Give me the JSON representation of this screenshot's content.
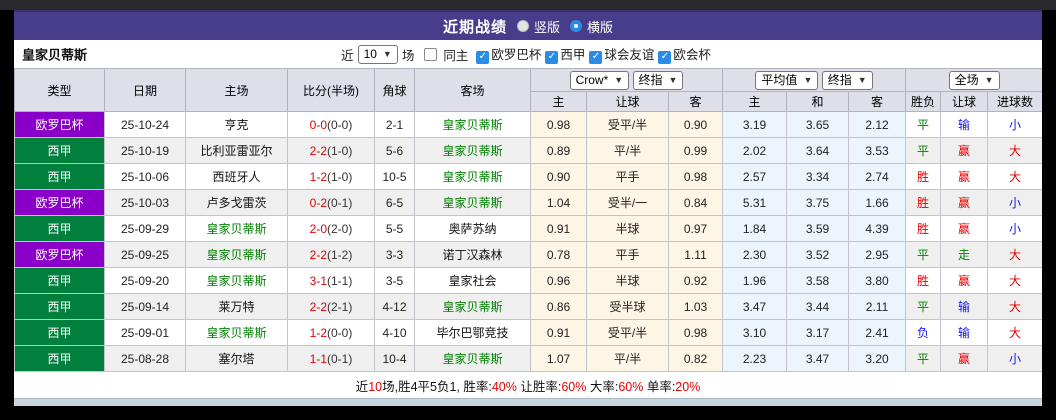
{
  "title_bar": {
    "title": "近期战绩",
    "radio_vertical": "竖版",
    "radio_horizontal": "横版",
    "selected": "横版"
  },
  "filter": {
    "team": "皇家贝蒂斯",
    "prefix": "近",
    "count_value": "10",
    "suffix": "场",
    "same_home": {
      "label": "同主",
      "checked": false
    },
    "leagues": [
      {
        "label": "欧罗巴杯",
        "checked": true
      },
      {
        "label": "西甲",
        "checked": true
      },
      {
        "label": "球会友谊",
        "checked": true
      },
      {
        "label": "欧会杯",
        "checked": true
      }
    ]
  },
  "table": {
    "selects": {
      "company": "Crow*",
      "company_final": "终指",
      "average": "平均值",
      "average_final": "终指",
      "fulltime": "全场"
    },
    "columns": [
      "类型",
      "日期",
      "主场",
      "比分(半场)",
      "角球",
      "客场",
      "主",
      "让球",
      "客",
      "主",
      "和",
      "客",
      "胜负",
      "让球",
      "进球数"
    ],
    "rows": [
      {
        "league": "欧罗巴杯",
        "date": "25-10-24",
        "home": "亨克",
        "score": "0-0",
        "half": "(0-0)",
        "corner": "2-1",
        "away": "皇家贝蒂斯",
        "focus": "away",
        "crown_home": "0.98",
        "handicap": "受平/半",
        "crown_away": "0.90",
        "avg_home": "3.19",
        "avg_draw": "3.65",
        "avg_away": "2.12",
        "result_wdl": "平",
        "result_handicap": "输",
        "result_goals": "小"
      },
      {
        "league": "西甲",
        "date": "25-10-19",
        "home": "比利亚雷亚尔",
        "score": "2-2",
        "half": "(1-0)",
        "corner": "5-6",
        "away": "皇家贝蒂斯",
        "focus": "away",
        "crown_home": "0.89",
        "handicap": "平/半",
        "crown_away": "0.99",
        "avg_home": "2.02",
        "avg_draw": "3.64",
        "avg_away": "3.53",
        "result_wdl": "平",
        "result_handicap": "赢",
        "result_goals": "大"
      },
      {
        "league": "西甲",
        "date": "25-10-06",
        "home": "西班牙人",
        "score": "1-2",
        "half": "(1-0)",
        "corner": "10-5",
        "away": "皇家贝蒂斯",
        "focus": "away",
        "crown_home": "0.90",
        "handicap": "平手",
        "crown_away": "0.98",
        "avg_home": "2.57",
        "avg_draw": "3.34",
        "avg_away": "2.74",
        "result_wdl": "胜",
        "result_handicap": "赢",
        "result_goals": "大"
      },
      {
        "league": "欧罗巴杯",
        "date": "25-10-03",
        "home": "卢多戈雷茨",
        "score": "0-2",
        "half": "(0-1)",
        "corner": "6-5",
        "away": "皇家贝蒂斯",
        "focus": "away",
        "crown_home": "1.04",
        "handicap": "受半/一",
        "crown_away": "0.84",
        "avg_home": "5.31",
        "avg_draw": "3.75",
        "avg_away": "1.66",
        "result_wdl": "胜",
        "result_handicap": "赢",
        "result_goals": "小"
      },
      {
        "league": "西甲",
        "date": "25-09-29",
        "home": "皇家贝蒂斯",
        "score": "2-0",
        "half": "(2-0)",
        "corner": "5-5",
        "away": "奥萨苏纳",
        "focus": "home",
        "crown_home": "0.91",
        "handicap": "半球",
        "crown_away": "0.97",
        "avg_home": "1.84",
        "avg_draw": "3.59",
        "avg_away": "4.39",
        "result_wdl": "胜",
        "result_handicap": "赢",
        "result_goals": "小"
      },
      {
        "league": "欧罗巴杯",
        "date": "25-09-25",
        "home": "皇家贝蒂斯",
        "score": "2-2",
        "half": "(1-2)",
        "corner": "3-3",
        "away": "诺丁汉森林",
        "focus": "home",
        "crown_home": "0.78",
        "handicap": "平手",
        "crown_away": "1.11",
        "avg_home": "2.30",
        "avg_draw": "3.52",
        "avg_away": "2.95",
        "result_wdl": "平",
        "result_handicap": "走",
        "result_goals": "大"
      },
      {
        "league": "西甲",
        "date": "25-09-20",
        "home": "皇家贝蒂斯",
        "score": "3-1",
        "half": "(1-1)",
        "corner": "3-5",
        "away": "皇家社会",
        "focus": "home",
        "crown_home": "0.96",
        "handicap": "半球",
        "crown_away": "0.92",
        "avg_home": "1.96",
        "avg_draw": "3.58",
        "avg_away": "3.80",
        "result_wdl": "胜",
        "result_handicap": "赢",
        "result_goals": "大"
      },
      {
        "league": "西甲",
        "date": "25-09-14",
        "home": "莱万特",
        "score": "2-2",
        "half": "(2-1)",
        "corner": "4-12",
        "away": "皇家贝蒂斯",
        "focus": "away",
        "crown_home": "0.86",
        "handicap": "受半球",
        "crown_away": "1.03",
        "avg_home": "3.47",
        "avg_draw": "3.44",
        "avg_away": "2.11",
        "result_wdl": "平",
        "result_handicap": "输",
        "result_goals": "大"
      },
      {
        "league": "西甲",
        "date": "25-09-01",
        "home": "皇家贝蒂斯",
        "score": "1-2",
        "half": "(0-0)",
        "corner": "4-10",
        "away": "毕尔巴鄂竞技",
        "focus": "home",
        "crown_home": "0.91",
        "handicap": "受平/半",
        "crown_away": "0.98",
        "avg_home": "3.10",
        "avg_draw": "3.17",
        "avg_away": "2.41",
        "result_wdl": "负",
        "result_handicap": "输",
        "result_goals": "大"
      },
      {
        "league": "西甲",
        "date": "25-08-28",
        "home": "塞尔塔",
        "score": "1-1",
        "half": "(0-1)",
        "corner": "10-4",
        "away": "皇家贝蒂斯",
        "focus": "away",
        "crown_home": "1.07",
        "handicap": "平/半",
        "crown_away": "0.82",
        "avg_home": "2.23",
        "avg_draw": "3.47",
        "avg_away": "3.20",
        "result_wdl": "平",
        "result_handicap": "赢",
        "result_goals": "小"
      }
    ]
  },
  "footer": {
    "segments": [
      {
        "text": "近",
        "color": "#111111"
      },
      {
        "text": "10",
        "color": "#e60000"
      },
      {
        "text": "场,胜4平5负1, 胜率:",
        "color": "#111111"
      },
      {
        "text": "40%",
        "color": "#e60000"
      },
      {
        "text": " 让胜率:",
        "color": "#111111"
      },
      {
        "text": "60%",
        "color": "#e60000"
      },
      {
        "text": " 大率:",
        "color": "#111111"
      },
      {
        "text": "60%",
        "color": "#e60000"
      },
      {
        "text": " 单率:",
        "color": "#111111"
      },
      {
        "text": "20%",
        "color": "#e60000"
      }
    ]
  },
  "colors": {
    "accent_bar": "#483d8b",
    "league": {
      "欧罗巴杯": "#8a00c8",
      "西甲": "#00803c"
    },
    "score_fulltime": "#e60000",
    "focus_team": "#008000",
    "result": {
      "胜": "#e60000",
      "平": "#008000",
      "负": "#1414e6",
      "赢": "#e60000",
      "走": "#008000",
      "输": "#1414e6",
      "大": "#e60000",
      "小": "#1414e6"
    }
  }
}
